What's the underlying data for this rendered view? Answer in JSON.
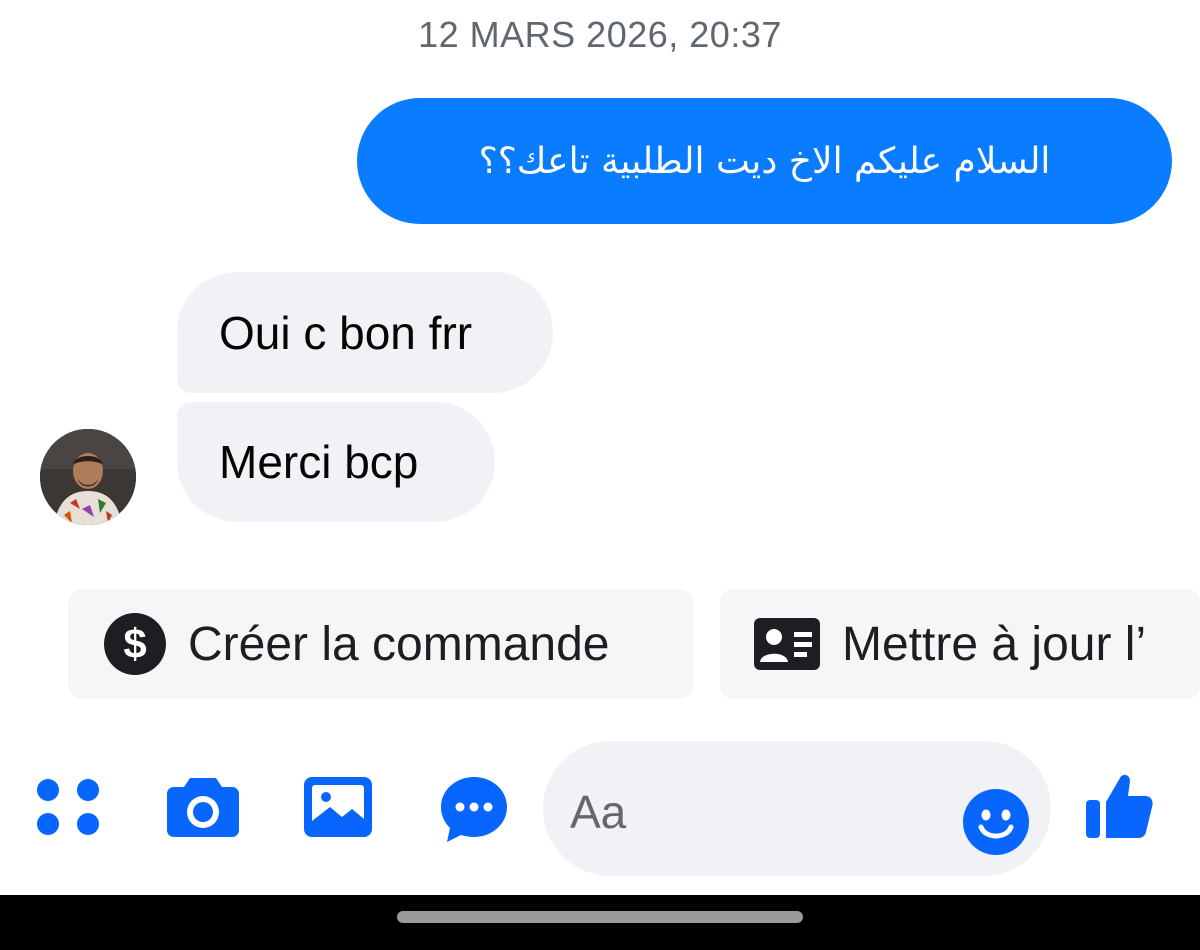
{
  "conversation": {
    "timestamp": "12 MARS 2026, 20:37",
    "messages": [
      {
        "direction": "outgoing",
        "text": "السلام عليكم الاخ ديت الطلبية تاعك؟؟"
      },
      {
        "direction": "incoming",
        "text": "Oui c bon frr"
      },
      {
        "direction": "incoming",
        "text": "Merci bcp"
      }
    ]
  },
  "quick_replies": [
    {
      "label": "Créer la commande",
      "icon": "dollar-circle-icon"
    },
    {
      "label": "Mettre à jour l’",
      "icon": "contact-card-icon"
    }
  ],
  "composer": {
    "placeholder": "Aa",
    "icons": [
      "apps-grid-icon",
      "camera-icon",
      "image-gallery-icon",
      "chat-bubble-icon",
      "emoji-icon",
      "thumbs-up-icon"
    ]
  },
  "colors": {
    "accent": "#0a7cff",
    "icon_blue": "#0866ff",
    "incoming_bubble": "#f0f2f5",
    "quick_reply_bg": "#f5f6f7",
    "dark_icon": "#1c1e21"
  }
}
